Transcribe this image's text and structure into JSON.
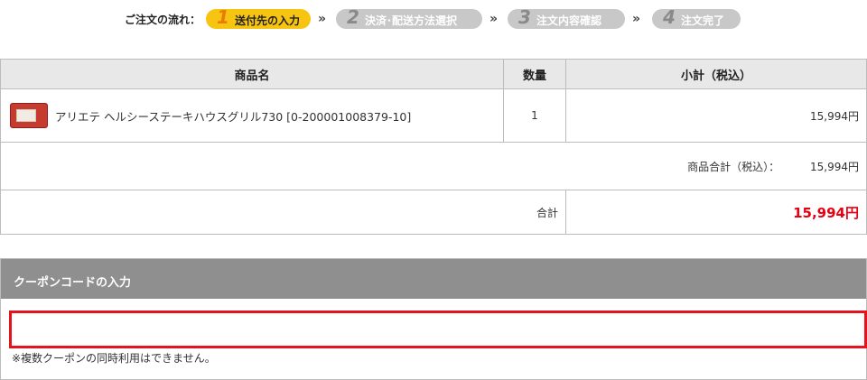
{
  "progress": {
    "label": "ご注文の流れ：",
    "steps": [
      {
        "num": "1",
        "label": "送付先の入力",
        "active": true
      },
      {
        "num": "2",
        "label": "決済･配送方法選択",
        "active": false
      },
      {
        "num": "3",
        "label": "注文内容確認",
        "active": false
      },
      {
        "num": "4",
        "label": "注文完了",
        "active": false
      }
    ],
    "separator": "»"
  },
  "table": {
    "headers": {
      "product": "商品名",
      "quantity": "数量",
      "subtotal": "小計（税込）"
    },
    "row": {
      "name": "アリエテ ヘルシーステーキハウスグリル730 [0-200001008379-10]",
      "quantity": "1",
      "subtotal": "15,994円"
    },
    "product_total_label": "商品合計（税込）：",
    "product_total_value": "15,994円",
    "total_label": "合計",
    "total_value": "15,994円"
  },
  "coupon": {
    "title": "クーポンコードの入力",
    "input_value": "",
    "note": "※複数クーポンの同時利用はできません。"
  },
  "colors": {
    "active_step": "#f7c411",
    "inactive_step": "#c8c8c8",
    "total": "#e60012",
    "input_border": "#e3141e"
  }
}
